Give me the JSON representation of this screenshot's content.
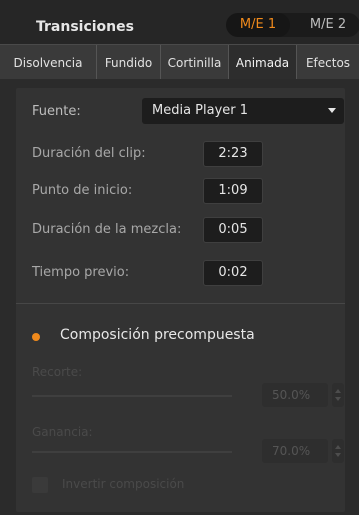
{
  "header": {
    "title": "Transiciones",
    "me_buttons": [
      "M/E 1",
      "M/E 2"
    ],
    "accent": "#f08a1c"
  },
  "tabs": [
    {
      "label": "Disolvencia"
    },
    {
      "label": "Fundido"
    },
    {
      "label": "Cortinilla"
    },
    {
      "label": "Animada"
    },
    {
      "label": "Efectos"
    }
  ],
  "active_tab": "Animada",
  "source": {
    "label": "Fuente:",
    "value": "Media Player 1"
  },
  "fields": [
    {
      "label": "Duración del clip:",
      "value": "2:23"
    },
    {
      "label": "Punto de inicio:",
      "value": "1:09"
    },
    {
      "label": "Duración de la mezcla:",
      "value": "0:05"
    },
    {
      "label": "Tiempo previo:",
      "value": "0:02"
    }
  ],
  "precomposed": {
    "title": "Composición precompuesta",
    "clip_label": "Recorte:",
    "clip_value": "50.0%",
    "gain_label": "Ganancia:",
    "gain_value": "70.0%",
    "invert_label": "Invertir composición"
  }
}
